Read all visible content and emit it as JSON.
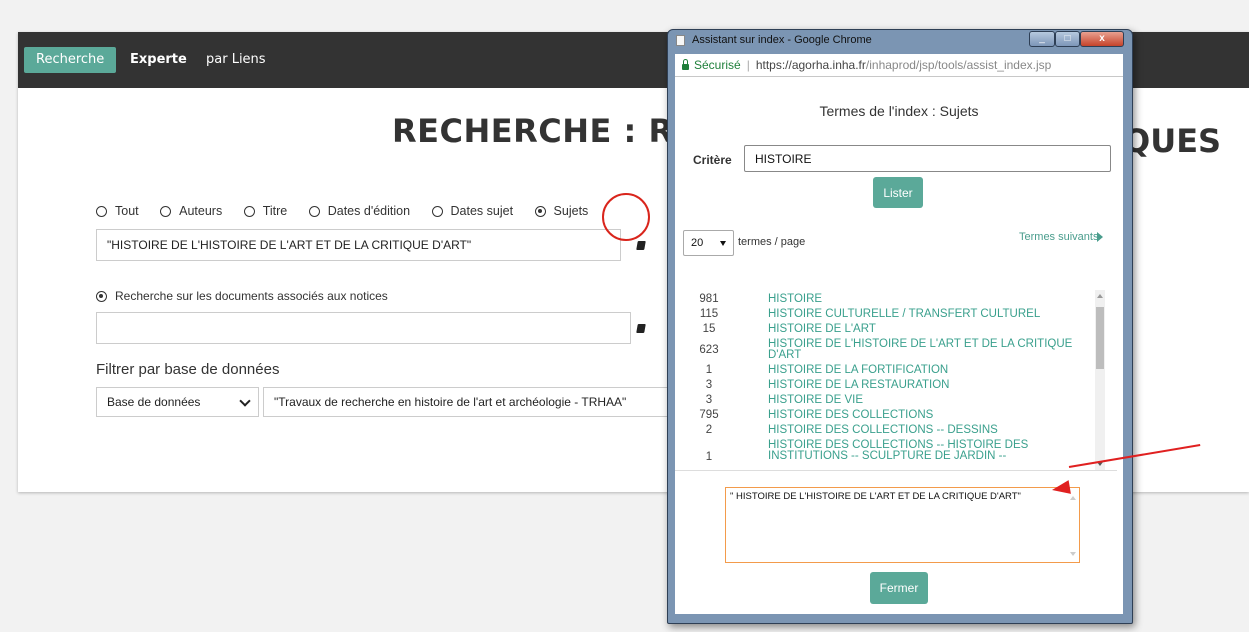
{
  "nav": {
    "tabs": [
      {
        "label": "Recherche"
      },
      {
        "label": "Experte"
      },
      {
        "label": "par Liens"
      }
    ]
  },
  "page": {
    "title": "RECHERCHE : RÉ",
    "title_right_fragment": "QUES"
  },
  "search_scope": {
    "options": [
      {
        "label": "Tout",
        "selected": false
      },
      {
        "label": "Auteurs",
        "selected": false
      },
      {
        "label": "Titre",
        "selected": false
      },
      {
        "label": "Dates d'édition",
        "selected": false
      },
      {
        "label": "Dates sujet",
        "selected": false
      },
      {
        "label": "Sujets",
        "selected": true
      }
    ],
    "query_value": "\"HISTOIRE DE L'HISTOIRE DE L'ART ET DE LA CRITIQUE D'ART\""
  },
  "documents": {
    "radio_label": "Recherche sur les documents associés aux notices",
    "value": ""
  },
  "filter": {
    "title": "Filtrer par base de données",
    "select_value": "Base de données",
    "database_value": "\"Travaux de recherche en histoire de l'art et archéologie - TRHAA\""
  },
  "popup": {
    "window_title": "Assistant sur index - Google Chrome",
    "url": {
      "secure_label": "Sécurisé",
      "scheme_host": "https://agorha.inha.fr",
      "path": "/inhaprod/jsp/tools/assist_index.jsp"
    },
    "title": "Termes de l'index : Sujets",
    "criteria_label": "Critère",
    "criteria_value": "HISTOIRE",
    "list_button": "Lister",
    "per_page_value": "20",
    "per_page_label": "termes / page",
    "next_link": "Termes suivants",
    "terms": [
      {
        "count": "981",
        "term": "HISTOIRE"
      },
      {
        "count": "115",
        "term": "HISTOIRE CULTURELLE / TRANSFERT CULTUREL"
      },
      {
        "count": "15",
        "term": "HISTOIRE DE L'ART"
      },
      {
        "count": "623",
        "term": "HISTOIRE DE L'HISTOIRE DE L'ART ET DE LA CRITIQUE D'ART"
      },
      {
        "count": "1",
        "term": "HISTOIRE DE LA FORTIFICATION"
      },
      {
        "count": "3",
        "term": "HISTOIRE DE LA RESTAURATION"
      },
      {
        "count": "3",
        "term": "HISTOIRE DE VIE"
      },
      {
        "count": "795",
        "term": "HISTOIRE DES COLLECTIONS"
      },
      {
        "count": "2",
        "term": "HISTOIRE DES COLLECTIONS -- DESSINS"
      },
      {
        "count": "1",
        "term": "HISTOIRE DES COLLECTIONS -- HISTOIRE DES INSTITUTIONS -- SCULPTURE DE JARDIN --"
      }
    ],
    "selection_text": "\" HISTOIRE DE L'HISTOIRE DE L'ART ET DE LA CRITIQUE D'ART\"",
    "close_button": "Fermer"
  },
  "colors": {
    "accent": "#5ba999",
    "annotation": "#e02020",
    "topbar": "#333333"
  }
}
